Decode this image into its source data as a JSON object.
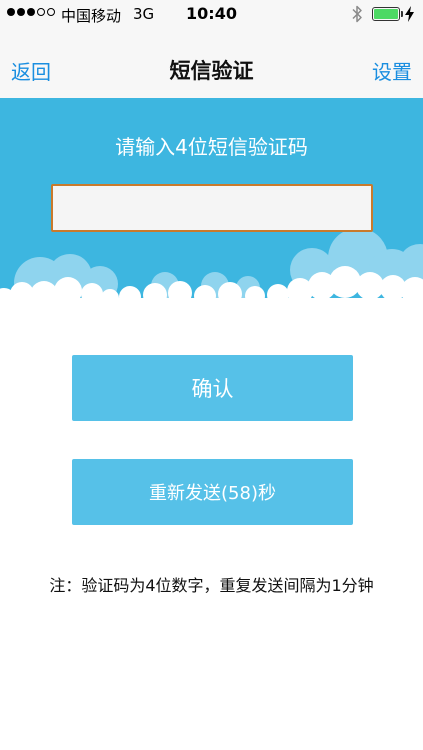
{
  "status_bar": {
    "carrier": "中国移动",
    "network": "3G",
    "time": "10:40"
  },
  "nav": {
    "back_label": "返回",
    "title": "短信验证",
    "settings_label": "设置"
  },
  "header": {
    "prompt": "请输入4位短信验证码",
    "code_input_value": "",
    "code_input_placeholder": ""
  },
  "buttons": {
    "confirm_label": "确认",
    "resend_label": "重新发送(58)秒"
  },
  "note": "注：验证码为4位数字，重复发送间隔为1分钟",
  "colors": {
    "accent": "#1a8ee0",
    "header_blue": "#3db6e0",
    "button_blue": "#56c1e8",
    "input_border": "#c97a2c",
    "battery_green": "#4cd964"
  }
}
